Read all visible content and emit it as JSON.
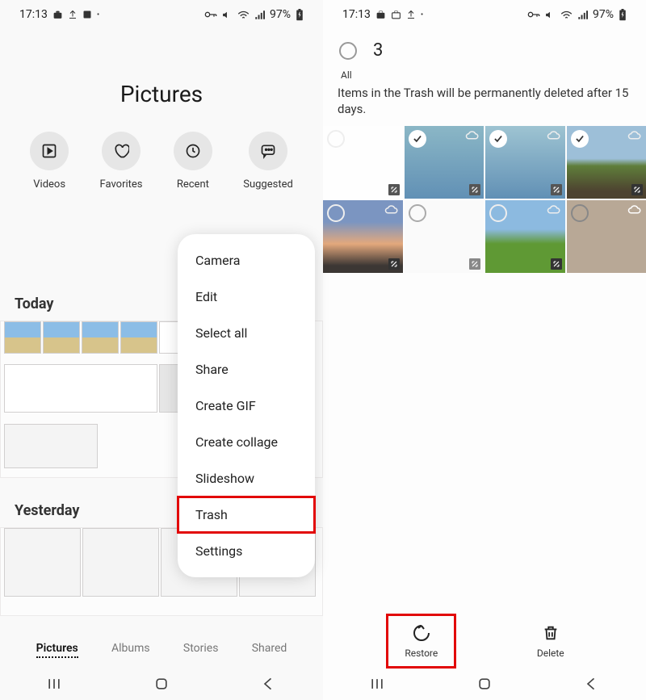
{
  "status": {
    "time": "17:13",
    "battery": "97%"
  },
  "left": {
    "title": "Pictures",
    "categories": [
      {
        "label": "Videos"
      },
      {
        "label": "Favorites"
      },
      {
        "label": "Recent"
      },
      {
        "label": "Suggested"
      }
    ],
    "sections": {
      "today": "Today",
      "yesterday": "Yesterday"
    },
    "tabs": {
      "pictures": "Pictures",
      "albums": "Albums",
      "stories": "Stories",
      "shared": "Shared"
    },
    "menu": [
      "Camera",
      "Edit",
      "Select all",
      "Share",
      "Create GIF",
      "Create collage",
      "Slideshow",
      "Trash",
      "Settings"
    ],
    "highlighted_menu_index": 7
  },
  "right": {
    "all_label": "All",
    "selected_count": "3",
    "trash_message": "Items in the Trash will be permanently deleted after 15 days.",
    "grid_states": [
      {
        "selected": false
      },
      {
        "selected": true
      },
      {
        "selected": true
      },
      {
        "selected": true
      },
      {
        "selected": false
      },
      {
        "selected": false
      },
      {
        "selected": false
      },
      {
        "selected": false
      }
    ],
    "actions": {
      "restore": "Restore",
      "delete": "Delete"
    }
  }
}
